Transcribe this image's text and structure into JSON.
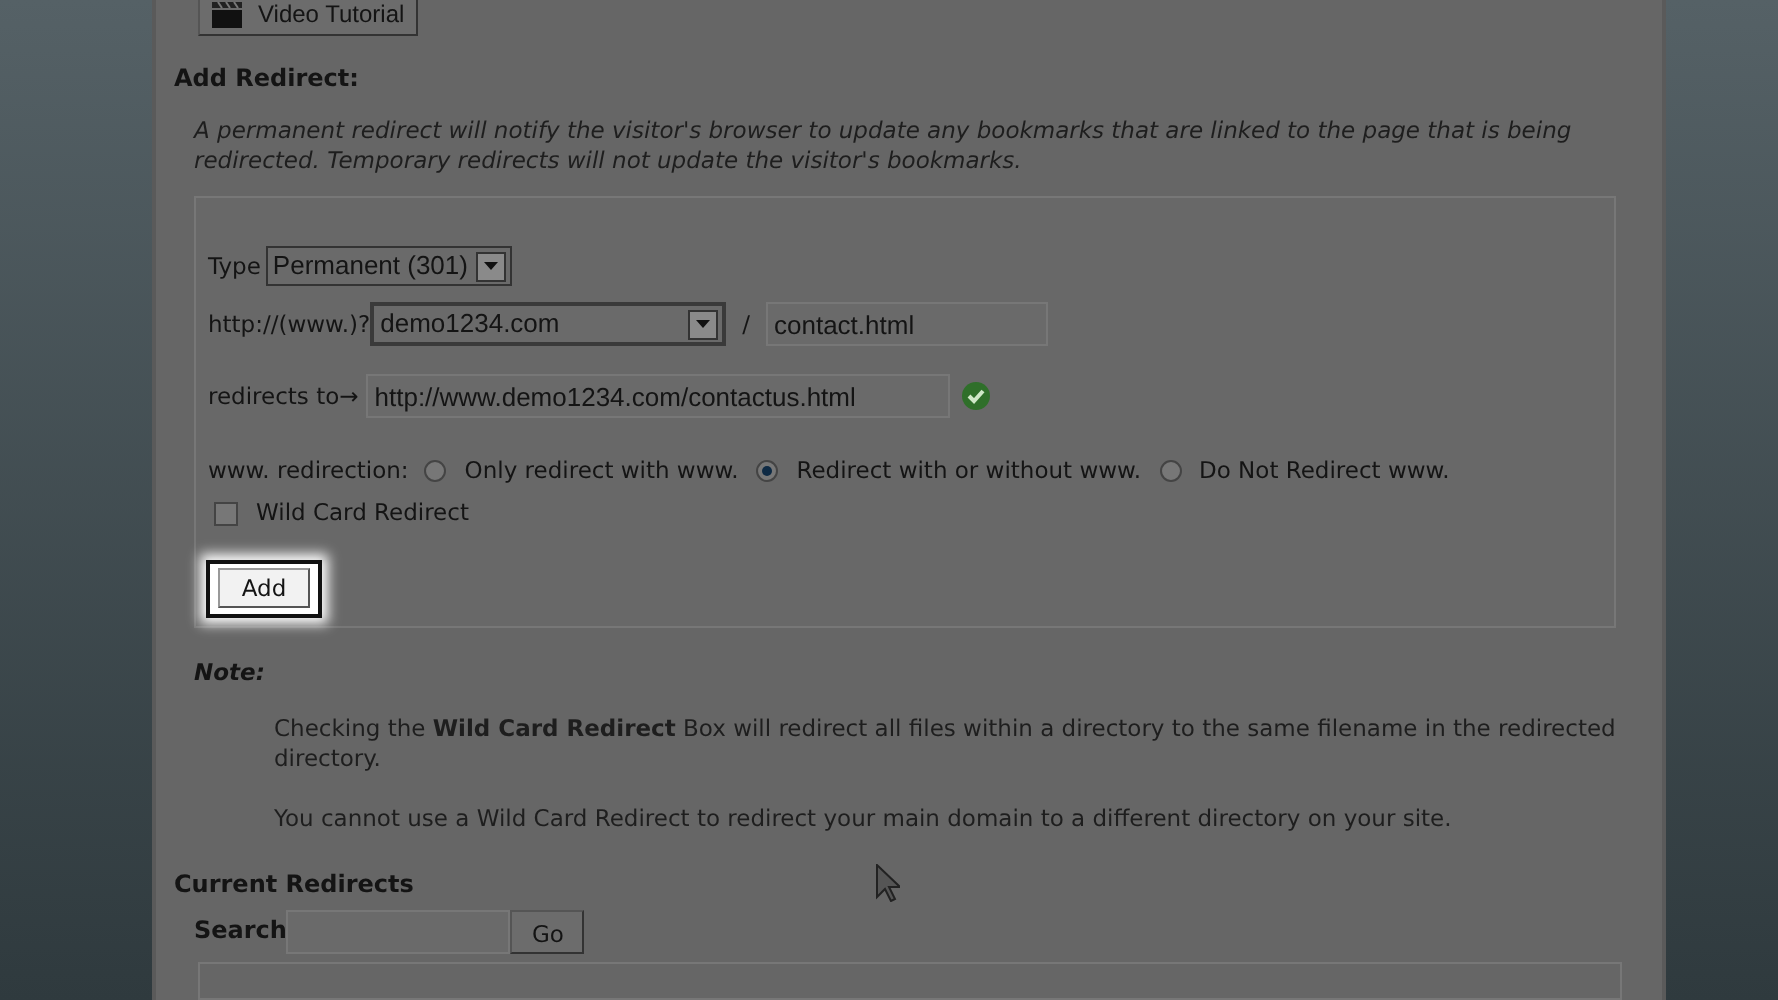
{
  "video_tutorial_button": "Video Tutorial",
  "section_title": "Add Redirect:",
  "description": "A permanent redirect will notify the visitor's browser to update any bookmarks that are linked to the page that is being redirected. Temporary redirects will not update the visitor's bookmarks.",
  "form": {
    "type_label": "Type",
    "type_value": "Permanent (301)",
    "domain_label": "http://(www.)?",
    "domain_value": "demo1234.com",
    "separator": "/",
    "path_value": "contact.html",
    "redirects_to_label": "redirects to→",
    "redirects_to_value": "http://www.demo1234.com/contactus.html",
    "valid": true,
    "www_label": "www. redirection:",
    "www_options": [
      {
        "label": "Only redirect with www.",
        "selected": false
      },
      {
        "label": "Redirect with or without www.",
        "selected": true
      },
      {
        "label": "Do Not Redirect www.",
        "selected": false
      }
    ],
    "wildcard": {
      "label": "Wild Card Redirect",
      "checked": false
    },
    "add_button": {
      "label": "Add",
      "highlighted": true
    }
  },
  "note": {
    "title": "Note:",
    "paragraphs": [
      "Checking the **Wild Card Redirect** Box will redirect all files within a directory to the same filename in the redirected directory.",
      "You cannot use a Wild Card Redirect to redirect your main domain to a different directory on your site."
    ]
  },
  "current_redirects": {
    "title": "Current Redirects",
    "search_label": "Search",
    "go_button": "Go"
  }
}
